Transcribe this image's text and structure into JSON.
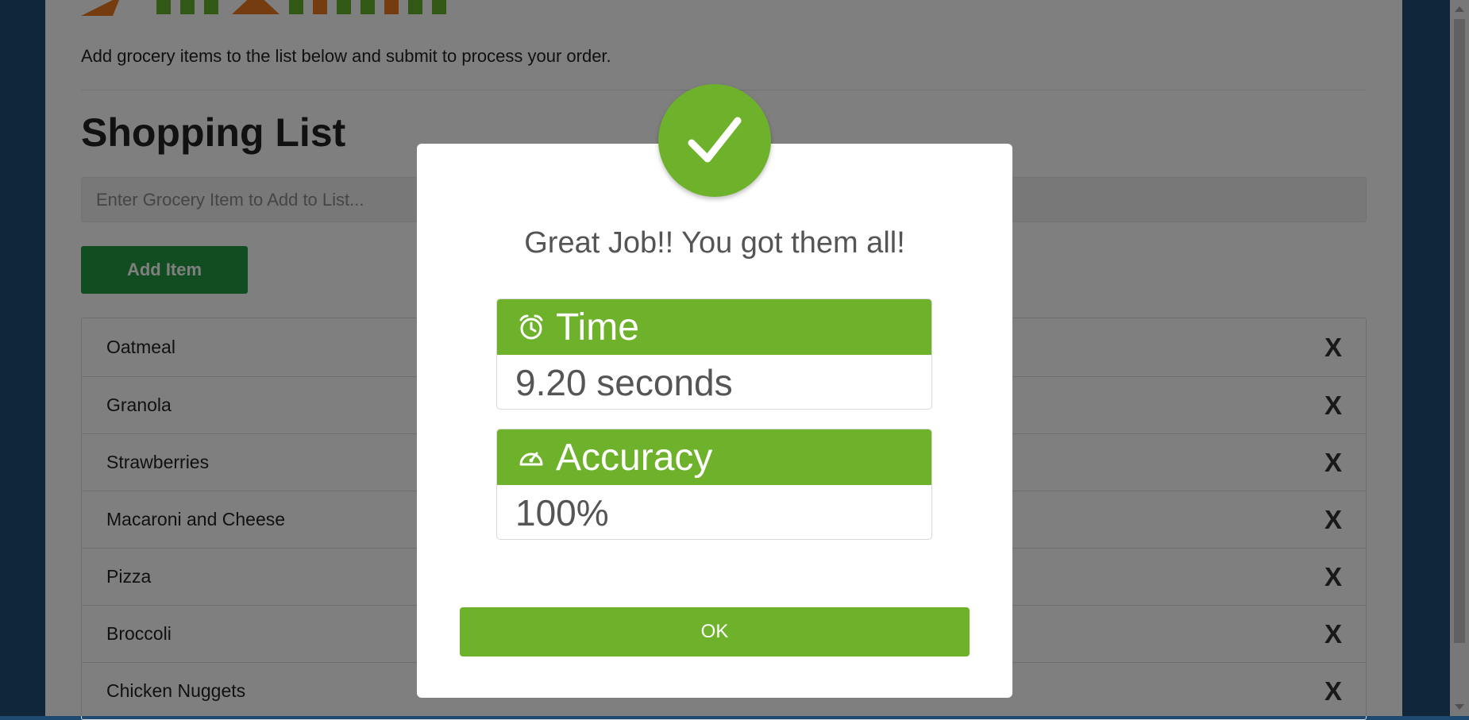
{
  "page": {
    "intro": "Add grocery items to the list below and submit to process your order.",
    "list_title": "Shopping List",
    "input_placeholder": "Enter Grocery Item to Add to List...",
    "add_button": "Add Item",
    "remove_glyph": "X",
    "items": [
      "Oatmeal",
      "Granola",
      "Strawberries",
      "Macaroni and Cheese",
      "Pizza",
      "Broccoli",
      "Chicken Nuggets"
    ]
  },
  "modal": {
    "icon": "checkmark-icon",
    "message": "Great Job!! You got them all!",
    "time": {
      "icon": "alarm-clock-icon",
      "label": "Time",
      "value": "9.20 seconds"
    },
    "accuracy": {
      "icon": "speedometer-icon",
      "label": "Accuracy",
      "value": "100%"
    },
    "ok_button": "OK"
  },
  "colors": {
    "accent_green": "#6eb22c",
    "button_green": "#239a43",
    "background_blue": "#1e4a72"
  }
}
